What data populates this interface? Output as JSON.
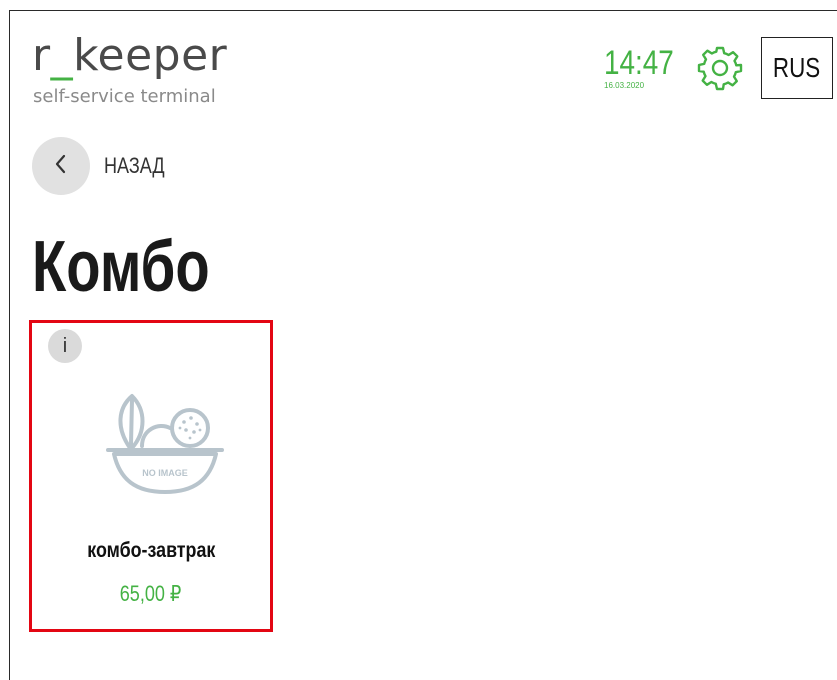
{
  "header": {
    "logo": {
      "prefix": "r",
      "separator": "_",
      "suffix": "keeper",
      "subtitle": "self-service terminal"
    },
    "clock": {
      "time": "14:47",
      "date": "16.03.2020"
    },
    "settings_icon": "gear-icon",
    "language_button": "RUS"
  },
  "navigation": {
    "back_label": "НАЗАД",
    "back_icon": "chevron-left-icon"
  },
  "page": {
    "title": "Комбо"
  },
  "products": [
    {
      "info_label": "i",
      "image_placeholder": "NO IMAGE",
      "name": "комбо-завтрак",
      "price": "65,00 ₽",
      "selected": true
    }
  ],
  "colors": {
    "accent_green": "#44b244",
    "selection_red": "#e30613",
    "back_button_bg": "#e1e1e1",
    "placeholder_gray": "#b8c4cc"
  }
}
